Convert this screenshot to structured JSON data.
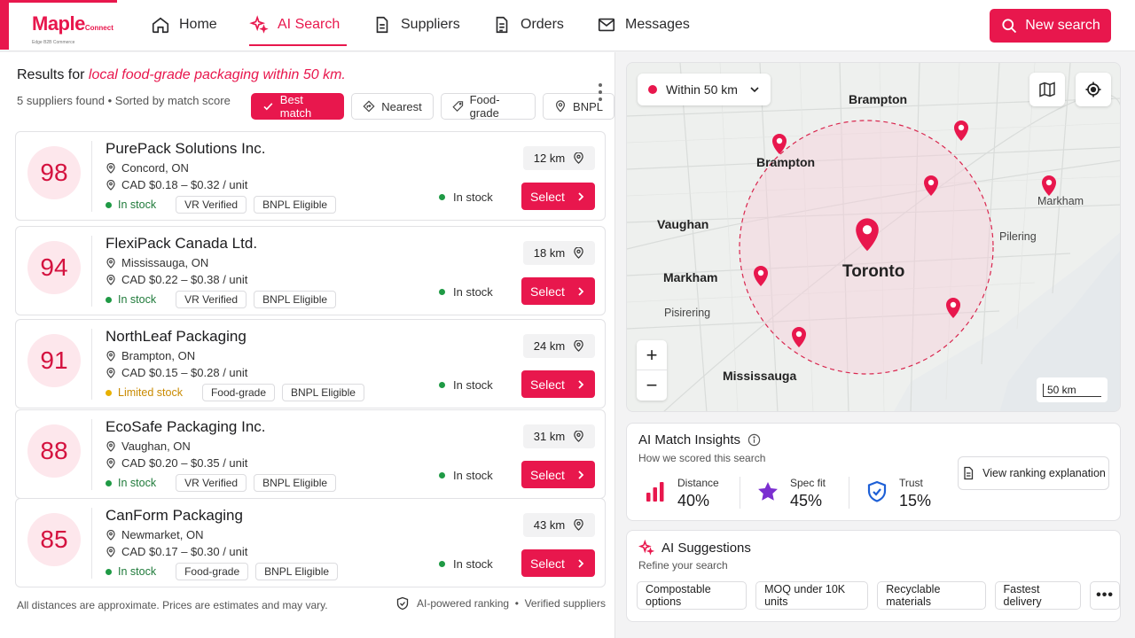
{
  "brand": {
    "name": "Maple",
    "suffix": "Connect",
    "tagline": "Edge B2B Commerce",
    "accent": "#e8174d"
  },
  "nav": {
    "items": [
      {
        "label": "Home",
        "icon": "home-icon"
      },
      {
        "label": "AI Search",
        "icon": "sparkle-icon",
        "active": true
      },
      {
        "label": "Suppliers",
        "icon": "document-icon"
      },
      {
        "label": "Orders",
        "icon": "clipboard-icon"
      },
      {
        "label": "Messages",
        "icon": "mail-icon"
      }
    ],
    "new_search_label": "New search"
  },
  "results": {
    "prefix": "Results for ",
    "query": "local food-grade packaging within 50 km.",
    "meta": "5 suppliers found • Sorted by match score",
    "filters": [
      {
        "label": "Best match",
        "icon": "check-icon",
        "active": true
      },
      {
        "label": "Nearest",
        "icon": "navigation-icon"
      },
      {
        "label": "Food-grade",
        "icon": "tag-icon"
      },
      {
        "label": "BNPL",
        "icon": "location-pin-icon"
      }
    ]
  },
  "suppliers": [
    {
      "score": "98",
      "name": "PurePack Solutions Inc.",
      "location": "Concord, ON",
      "price": "CAD $0.18 – $0.32 / unit",
      "stock": "In stock",
      "limited": false,
      "tags": [
        "VR Verified",
        "BNPL Eligible"
      ],
      "distance": "12 km",
      "availability": "In stock",
      "select": "Select"
    },
    {
      "score": "94",
      "name": "FlexiPack Canada Ltd.",
      "location": "Mississauga, ON",
      "price": "CAD $0.22 – $0.38 / unit",
      "stock": "In stock",
      "limited": false,
      "tags": [
        "VR Verified",
        "BNPL Eligible"
      ],
      "distance": "18 km",
      "availability": "In stock",
      "select": "Select"
    },
    {
      "score": "91",
      "name": "NorthLeaf Packaging",
      "location": "Brampton, ON",
      "price": "CAD $0.15 – $0.28 / unit",
      "stock": "Limited stock",
      "limited": true,
      "tags": [
        "Food-grade",
        "BNPL Eligible"
      ],
      "distance": "24 km",
      "availability": "In stock",
      "select": "Select"
    },
    {
      "score": "88",
      "name": "EcoSafe Packaging Inc.",
      "location": "Vaughan, ON",
      "price": "CAD $0.20 – $0.35 / unit",
      "stock": "In stock",
      "limited": false,
      "tags": [
        "VR Verified",
        "BNPL Eligible"
      ],
      "distance": "31 km",
      "availability": "In stock",
      "select": "Select"
    },
    {
      "score": "85",
      "name": "CanForm Packaging",
      "location": "Newmarket, ON",
      "price": "CAD $0.17 – $0.30 / unit",
      "stock": "In stock",
      "limited": false,
      "tags": [
        "Food-grade",
        "BNPL Eligible"
      ],
      "distance": "43 km",
      "availability": "In stock",
      "select": "Select"
    }
  ],
  "footer": {
    "note": "All distances are approximate. Prices are estimates and may vary.",
    "right": "AI-powered ranking  •  Verified suppliers"
  },
  "map": {
    "radius_label": "Within 50 km",
    "scale_label": "50 km",
    "zoom_in": "+",
    "zoom_out": "−",
    "cities": {
      "brampton_top": "Brampton",
      "brampton": "Brampton",
      "markham_right": "Markham",
      "vaughan": "Vaughan",
      "pickering_right": "Pilering",
      "markham": "Markham",
      "toronto": "Toronto",
      "pickering": "Pisirering",
      "mississauga": "Mississauga"
    }
  },
  "insights": {
    "title": "AI Match Insights",
    "subtitle": "How we scored this search",
    "metrics": [
      {
        "label": "Distance",
        "value": "40%",
        "icon": "bar-chart-icon"
      },
      {
        "label": "Spec fit",
        "value": "45%",
        "icon": "star-icon"
      },
      {
        "label": "Trust",
        "value": "15%",
        "icon": "shield-icon"
      }
    ],
    "view_ranking_label": "View ranking explanation"
  },
  "suggestions": {
    "title": "AI Suggestions",
    "subtitle": "Refine your search",
    "chips": [
      "Compostable options",
      "MOQ under 10K units",
      "Recyclable materials",
      "Fastest delivery"
    ],
    "more": "•••"
  }
}
